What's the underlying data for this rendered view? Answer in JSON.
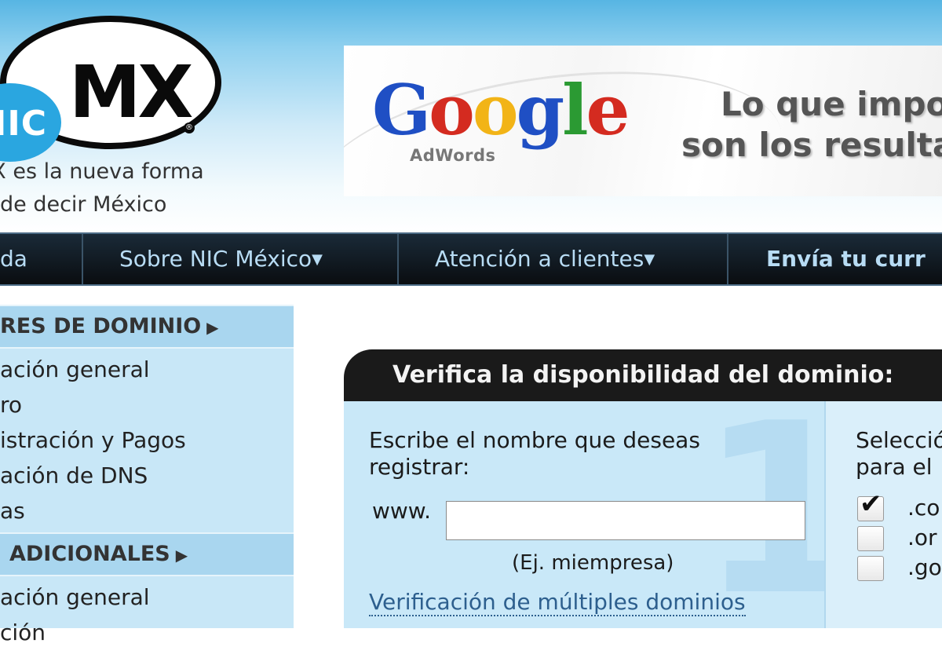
{
  "header": {
    "logo_nic": "NIC",
    "logo_mx": "MX",
    "logo_reg": "®",
    "tagline_line1": "MX es la nueva forma",
    "tagline_line2": "de decir México"
  },
  "banner": {
    "google_letters": [
      "G",
      "o",
      "o",
      "g",
      "l",
      "e"
    ],
    "adwords": "AdWords",
    "line1": "Lo que impor",
    "line2": "son los resultado"
  },
  "nav": {
    "items": [
      {
        "label": "da"
      },
      {
        "label": "Sobre NIC México",
        "dropdown": true
      },
      {
        "label": "Atención a clientes",
        "dropdown": true
      },
      {
        "label": "Envía tu curr"
      }
    ]
  },
  "sidebar": {
    "section1_title": "RES DE DOMINIO",
    "section1_items": [
      "ación general",
      "ro",
      "istración y Pagos",
      "ación de DNS",
      "as"
    ],
    "section2_title": "ADICIONALES",
    "section2_items": [
      "ación general",
      "ción"
    ]
  },
  "domain_check": {
    "title": "Verifica la disponibilidad del dominio:",
    "step_number": "1",
    "prompt": "Escribe el nombre que deseas registrar:",
    "www_label": "www.",
    "input_value": "",
    "example": "(Ej. miempresa)",
    "multi_link": "Verificación de múltiples dominios",
    "select_label_line1": "Selecció",
    "select_label_line2": "para el",
    "extensions": [
      {
        "label": ".co",
        "checked": true
      },
      {
        "label": ".or",
        "checked": false
      },
      {
        "label": ".go",
        "checked": false
      }
    ]
  },
  "colors": {
    "nav_text": "#b8dcf4",
    "sidebar_bg": "#c8e7f7",
    "panel_bg": "#c9e8f8",
    "link": "#2d5f8e"
  }
}
